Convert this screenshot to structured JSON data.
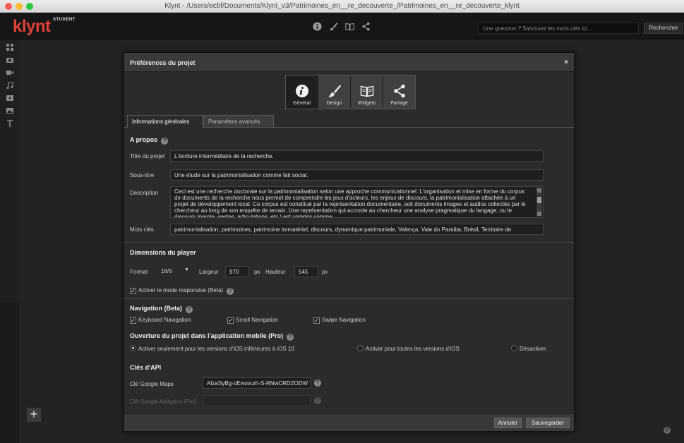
{
  "window": {
    "title": "Klynt - /Users/ecbf/Documents/Klynt_v3/Patrimoines_en__re_decouverte_/Patrimoines_en__re_decouverte_klynt"
  },
  "app": {
    "logo": "klynt",
    "logo_badge": "STUDENT",
    "search_placeholder": "Une question ? Saisissez les mots clés ici...",
    "search_button": "Rechercher",
    "add_button": "+",
    "help_button": "?"
  },
  "dialog": {
    "title": "Préférences du projet",
    "close": "×",
    "categories": [
      {
        "label": "Général",
        "icon": "info-icon"
      },
      {
        "label": "Design",
        "icon": "brush-icon"
      },
      {
        "label": "Widgets",
        "icon": "book-icon"
      },
      {
        "label": "Partage",
        "icon": "share-icon"
      }
    ],
    "subtabs": {
      "general": "Informations générales",
      "advanced": "Paramètres avancés"
    },
    "about": {
      "title": "A propos",
      "title_label": "Titre du projet",
      "title_value": "L'écriture intermédiaire de la recherche.",
      "subtitle_label": "Sous-titre",
      "subtitle_value": "Une étude sur la patrimonialisation comme fait social.",
      "description_label": "Description",
      "description_value": "Ceci est une recherche doctorale sur la patrimonialisation selon une approche communicationnel. L'organisation et mise en forme du corpus de documents de la recherche nous permet de comprendre les jeux d'acteurs, les enjeux de discours, la patrimonialisation attachée à un projet de développement local. Ce corpus est constitué par la représentation documentaire, soit documents images et audios collectés par le chercheur au long de son enquête de terrain. Une représentation qui accorde au chercheur une analyse pragmatique du langage, ou le discours (parole, gestes, articulations, etc.) est compris comme",
      "keywords_label": "Mots clés",
      "keywords_value": "patrimonialisation, patrimoines, patrimoine immatériel, discours, dynamique patrimoniale, Valença, Vale do Paraiba, Brésil, Territoire de"
    },
    "player": {
      "title": "Dimensions du player",
      "format_label": "Format",
      "format_value": "16/9",
      "width_label": "Largeur",
      "width_value": "970",
      "height_label": "Hauteur",
      "height_value": "545",
      "unit": "px",
      "responsive_label": "Activer le mode responsive (Beta)"
    },
    "navigation": {
      "title": "Navigation (Beta)",
      "keyboard": "Keyboard Navigation",
      "scroll": "Scroll Navigation",
      "swipe": "Swipe Navigation"
    },
    "mobile": {
      "title": "Ouverture du projet dans l'application mobile (Pro)",
      "opt_ios10": "Activer seulement pour les versions d'iOS inférieures à iOS 10",
      "opt_all": "Activer pour toutes les versions d'iOS",
      "opt_off": "Désactiver"
    },
    "api": {
      "title": "Clés d'API",
      "maps_label": "Clé Google Maps",
      "maps_value": "AIzaSyBg-oEwovurh-S-RNwCRDZODW",
      "analytics_label": "Clé Google Analytics (Pro)",
      "analytics_value": ""
    },
    "footer": {
      "cancel": "Annuler",
      "save": "Sauvegarder"
    }
  }
}
